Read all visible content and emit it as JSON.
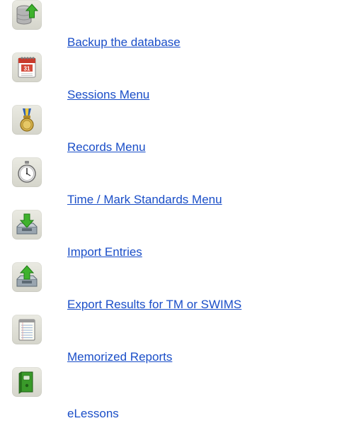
{
  "links": [
    {
      "label": "Backup the database",
      "icon": "database-upload-icon"
    },
    {
      "label": "Sessions Menu",
      "icon": "calendar-icon"
    },
    {
      "label": "Records Menu",
      "icon": "medal-icon"
    },
    {
      "label": "Time / Mark Standards Menu",
      "icon": "stopwatch-icon"
    },
    {
      "label": "Import Entries",
      "icon": "import-tray-icon"
    },
    {
      "label": "Export Results for TM or SWIMS",
      "icon": "export-tray-icon"
    },
    {
      "label": "Memorized Reports",
      "icon": "notepad-icon"
    },
    {
      "label": "eLessons",
      "icon": "green-binder-icon"
    }
  ],
  "colors": {
    "link": "#1a4ec8",
    "icon_tile": "#e0e0d8"
  }
}
